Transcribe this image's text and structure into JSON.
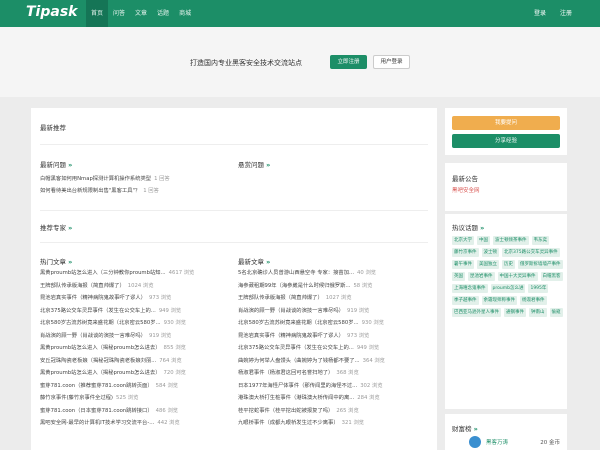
{
  "header": {
    "logo": "Tipask",
    "nav": [
      "首页",
      "问答",
      "文章",
      "话题",
      "商城"
    ],
    "login": "登录",
    "register": "注册"
  },
  "hero": {
    "slogan": "打造国内专业黑客安全技术交流站点",
    "register_button": "立即注册",
    "login_button": "用户登录"
  },
  "main": {
    "recommend_title": "最新推荐",
    "latest_questions_title": "最新问题",
    "bounty_questions_title": "悬赏问题",
    "more": "»",
    "latest_questions": [
      {
        "title": "白帽黑客如何用Nmap探测计算机操作系统类型",
        "count": "1 回答"
      },
      {
        "title": "如何看待美出台新规限制出售\"黑客工具\"？",
        "count": "1 回答"
      }
    ],
    "experts_title": "推荐专家",
    "hot_articles_title": "热门文章",
    "latest_articles_title": "最新文章",
    "hot_articles": [
      {
        "title": "黑黄proumb站怎么进入（三分钟教你proumb站知...",
        "count": "4617 浏览"
      },
      {
        "title": "王牌部队传承版海报（简直帅爆了）",
        "count": "1024 浏览"
      },
      {
        "title": "昆池岩真实事件（精神病院鬼故事吓了谬人）",
        "count": "973 浏览"
      },
      {
        "title": "北京375路公交车灵异事件（发生在公交车上的...",
        "count": "949 浏览"
      },
      {
        "title": "北京580岁古流苏树竟来盛花期（北京密云580岁...",
        "count": "930 浏览"
      },
      {
        "title": "肖战演的顾一野（肖战谈的演技一言难尽吗）",
        "count": "919 浏览"
      },
      {
        "title": "黑黄proumb站怎么进入（揭秘proumb怎么进去）",
        "count": "855 浏览"
      },
      {
        "title": "安丘冠珠陶瓷老板娘（揭秘冠珠陶瓷老板娘刘丽...",
        "count": "764 浏览"
      },
      {
        "title": "黑黄proumb站怎么进入（揭秘proumb怎么进去）",
        "count": "720 浏览"
      },
      {
        "title": "蜜芽781.coon（推荐蜜芽781.coon跳转页面）",
        "count": "584 浏览"
      },
      {
        "title": "藤竹京事件(藤竹京事件全过程)",
        "count": "525 浏览"
      },
      {
        "title": "蜜芽781.coon（日本蜜芽781.coon跳转接口）",
        "count": "486 浏览"
      },
      {
        "title": "黑吧安全网-最早的计算机IT技术学习交流平台-...",
        "count": "442 浏览"
      }
    ],
    "latest_articles": [
      {
        "title": "5名北京确诊人员曾游山西悬空寺 专家：接苗加...",
        "count": "40 浏览"
      },
      {
        "title": "海参葳租期99年（海参崴是什么时候归俄罗斯...",
        "count": "58 浏览"
      },
      {
        "title": "王牌部队传承版海报（简直帅爆了）",
        "count": "1027 浏览"
      },
      {
        "title": "肖战演的顾一野（肖战谈的演技一言难尽吗）",
        "count": "919 浏览"
      },
      {
        "title": "北京580岁古流苏树竟来盛花期（北京密云580岁...",
        "count": "930 浏览"
      },
      {
        "title": "昆池岩真实事件（精神病院鬼故事吓了谬人）",
        "count": "973 浏览"
      },
      {
        "title": "北京375路公交车灵异事件（发生在公交车上的...",
        "count": "949 浏览"
      },
      {
        "title": "曲婉婷为何举人盘馒头（曲婉婷为了钱杨都不要了...",
        "count": "364 浏览"
      },
      {
        "title": "杨淑君事件（杨淑君这回可名誉扫地了）",
        "count": "368 浏览"
      },
      {
        "title": "日本1977年海怪尸体事件（那传闻里的海怪不过...",
        "count": "302 浏览"
      },
      {
        "title": "港珠澳大桥打生桩事件（港珠澳大桥传闻中的离...",
        "count": "284 浏览"
      },
      {
        "title": "桂平挖蛇事件（桂平挖出蛇被报复了吗）",
        "count": "265 浏览"
      },
      {
        "title": "九眼桥事件（成都九眼桥发生过不少离事）",
        "count": "321 浏览"
      }
    ]
  },
  "sidebar": {
    "ask_button": "我要提问",
    "share_button": "分享经验",
    "notice_title": "最新公告",
    "notice_item": "黑吧安全网",
    "tags_title": "热议话题",
    "tags": [
      "北京大学",
      "中国",
      "波士顿倾茶事件",
      "韦东奕",
      "藤竹京事件",
      "波士顿",
      "北京375路公交车灵异事件",
      "暑午事件",
      "美国独立",
      "历史",
      "俄罗斯拆墙墙产事件",
      "英国",
      "昆池岩事件",
      "中国十大灵异事件",
      "白帽黑客",
      "上海嘻念鬼事件",
      "proumb怎么进",
      "1995年",
      "季子越事件",
      "余霜现师称事件",
      "杨淑君事件",
      "巴西亚马逊外星人事件",
      "通钢事件",
      "钟南山",
      "偷窥"
    ],
    "rank_title": "财富榜",
    "rank_items": [
      {
        "name": "黑客万涛",
        "value": "20 金币"
      }
    ]
  },
  "colors": {
    "brand": "#1c8e67",
    "orange": "#f0ad4e",
    "link_red": "#d9534f"
  }
}
